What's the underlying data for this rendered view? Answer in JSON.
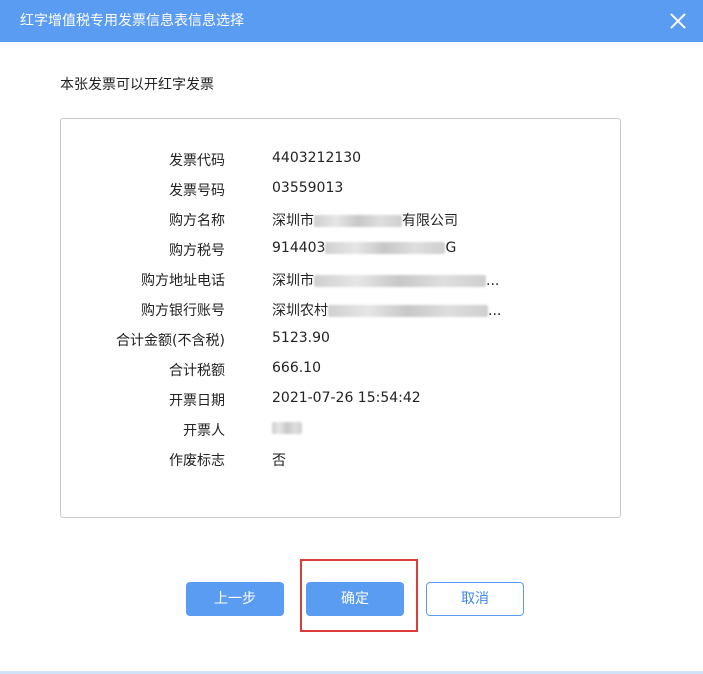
{
  "dialog": {
    "title": "红字增值税专用发票信息表信息选择",
    "notice": "本张发票可以开红字发票"
  },
  "invoice": {
    "rows": [
      {
        "label": "发票代码",
        "value": "4403212130"
      },
      {
        "label": "发票号码",
        "value": "03559013"
      },
      {
        "label": "购方名称",
        "value_prefix": "深圳市",
        "value_suffix": "有限公司"
      },
      {
        "label": "购方税号",
        "value_prefix": "914403",
        "value_suffix": "G"
      },
      {
        "label": "购方地址电话",
        "value_prefix": "深圳市",
        "value_suffix": "..."
      },
      {
        "label": "购方银行账号",
        "value_prefix": "深圳农村",
        "value_suffix": "..."
      },
      {
        "label": "合计金额(不含税)",
        "value": "5123.90"
      },
      {
        "label": "合计税额",
        "value": "666.10"
      },
      {
        "label": "开票日期",
        "value": "2021-07-26 15:54:42"
      },
      {
        "label": "开票人",
        "value": ""
      },
      {
        "label": "作废标志",
        "value": "否"
      }
    ]
  },
  "buttons": {
    "prev": "上一步",
    "ok": "确定",
    "cancel": "取消"
  },
  "colors": {
    "titlebar": "#5b9cf3",
    "highlight": "#e03b3b"
  }
}
